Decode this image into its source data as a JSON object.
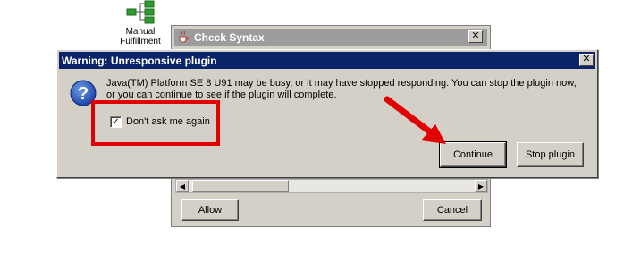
{
  "desktop": {
    "node_label_line1": "Manual",
    "node_label_line2": "Fulfillment",
    "node_icon": "workflow-tree-icon",
    "node_color": "#2e9b2e"
  },
  "background_dialog": {
    "title": "Check Syntax",
    "title_icon": "java-cup-icon",
    "close_glyph": "✕",
    "allow_label": "Allow",
    "cancel_label": "Cancel"
  },
  "warning_dialog": {
    "title": "Warning: Unresponsive plugin",
    "close_glyph": "✕",
    "icon": "question-icon",
    "message_line1": "Java(TM) Platform SE 8 U91 may be busy, or it may have stopped responding. You can stop the plugin now,",
    "message_line2": "or you can continue to see if the plugin will complete.",
    "checkbox_label": "Don't ask me again",
    "checkbox_checked": true,
    "checkbox_mark": "✓",
    "continue_label": "Continue",
    "stop_label": "Stop plugin"
  },
  "annotation": {
    "color": "#e00000"
  }
}
